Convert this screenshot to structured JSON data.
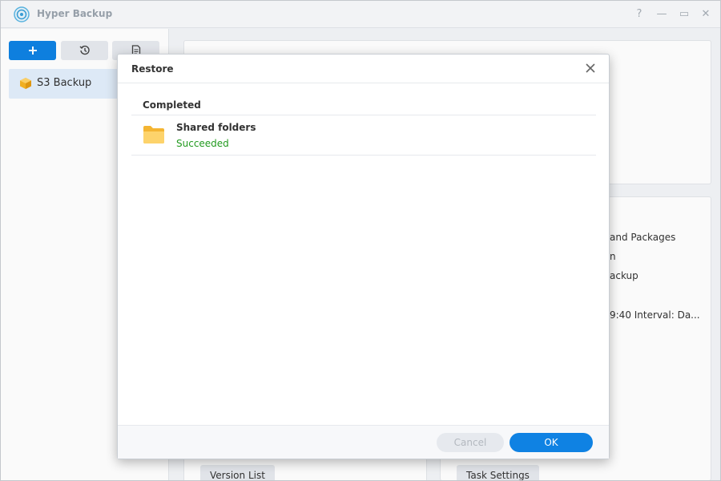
{
  "app": {
    "title": "Hyper Backup",
    "window_controls": [
      "?",
      "—",
      "▭",
      "✕"
    ]
  },
  "sidebar": {
    "toolbar": [
      {
        "name": "add-button",
        "icon": "plus-icon"
      },
      {
        "name": "restore-history-button",
        "icon": "history-icon"
      },
      {
        "name": "log-button",
        "icon": "document-icon"
      }
    ],
    "tasks": [
      {
        "label": "S3 Backup",
        "icon": "package-cube-icon"
      }
    ]
  },
  "background_panel": {
    "lines": [
      "and Packages",
      "n",
      "ackup",
      "9:40 Interval: Da..."
    ],
    "buttons": {
      "version_list": "Version List",
      "task_settings": "Task Settings"
    }
  },
  "dialog": {
    "title": "Restore",
    "section_title": "Completed",
    "results": [
      {
        "name": "Shared folders",
        "status": "Succeeded",
        "icon": "folder-icon"
      }
    ],
    "buttons": {
      "cancel": "Cancel",
      "ok": "OK"
    }
  },
  "colors": {
    "primary": "#0f82e3",
    "success": "#229a1f",
    "disabled_text": "#b3b8bf",
    "selected_bg": "#e2eefb"
  }
}
